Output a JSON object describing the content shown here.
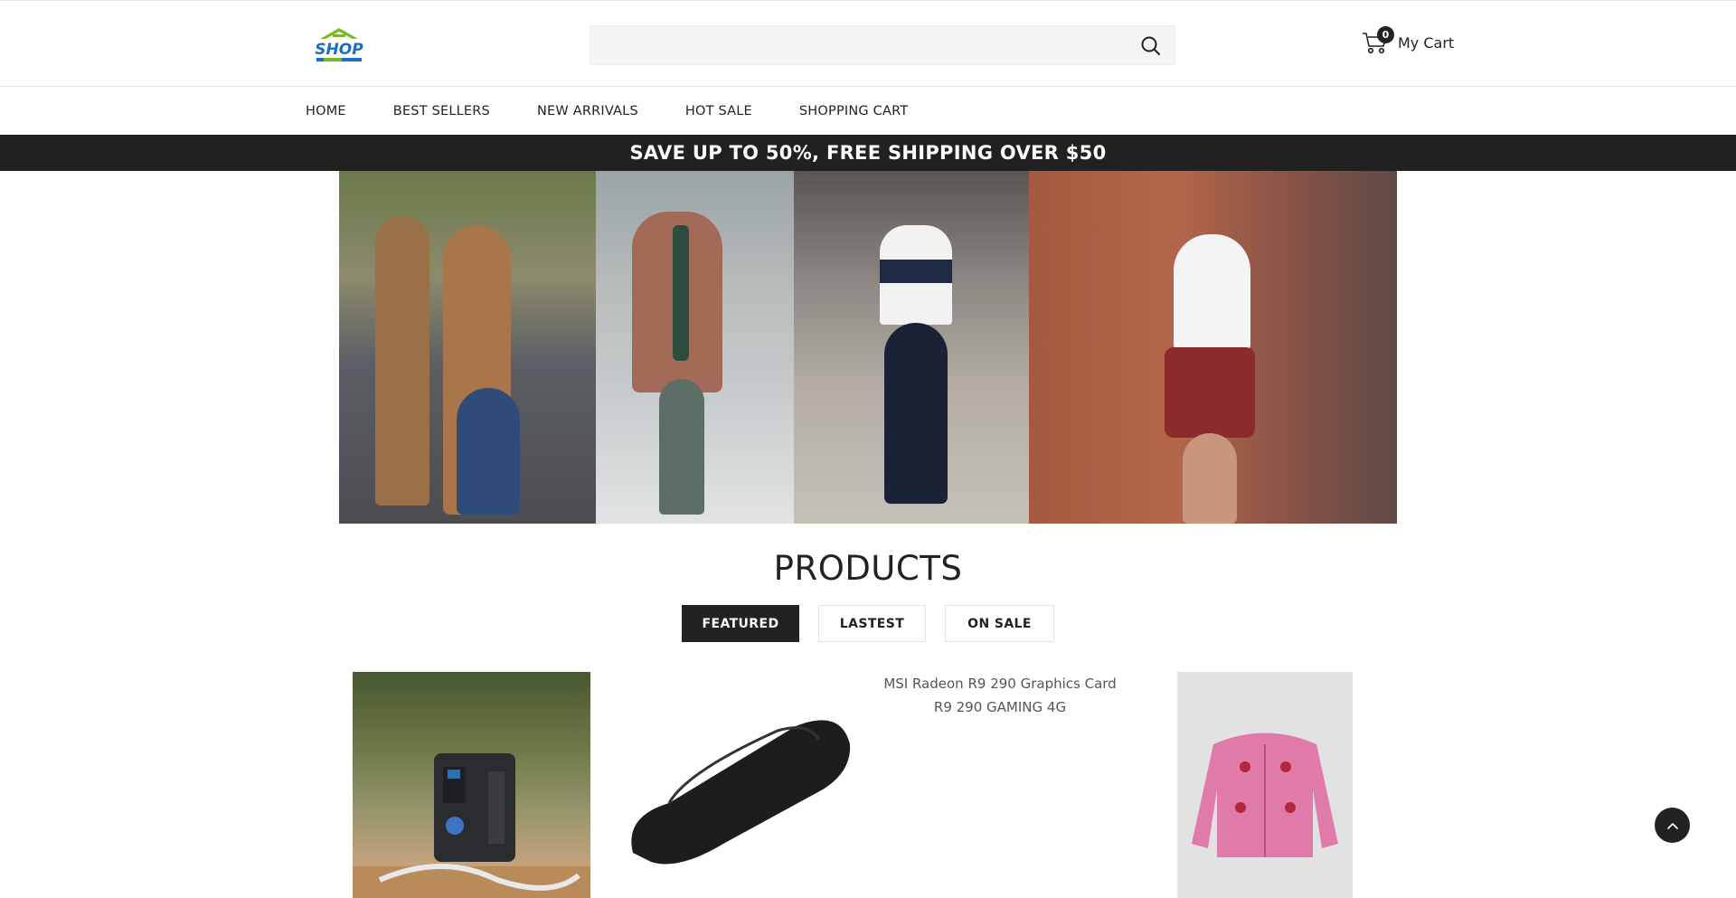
{
  "header": {
    "logo_text": "SHOP",
    "search": {
      "value": "",
      "placeholder": ""
    },
    "cart": {
      "count": "0",
      "label": "My Cart"
    }
  },
  "nav": {
    "items": [
      {
        "label": "HOME"
      },
      {
        "label": "BEST SELLERS"
      },
      {
        "label": "NEW ARRIVALS"
      },
      {
        "label": "HOT SALE"
      },
      {
        "label": "SHOPPING CART"
      }
    ]
  },
  "promo": {
    "text": "SAVE UP TO 50%, FREE SHIPPING OVER $50"
  },
  "products": {
    "title": "PRODUCTS",
    "tabs": [
      {
        "label": "FEATURED",
        "active": true
      },
      {
        "label": "LASTEST",
        "active": false
      },
      {
        "label": "ON SALE",
        "active": false
      }
    ],
    "items": [
      {
        "alt": ""
      },
      {
        "alt": ""
      },
      {
        "alt": "MSI Radeon R9 290 Graphics Card R9 290 GAMING 4G"
      },
      {
        "alt": ""
      }
    ]
  },
  "colors": {
    "promo_bg": "#212121",
    "active_tab_bg": "#222222",
    "logo_green": "#7cb82f",
    "logo_blue": "#1b6fc3"
  },
  "icons": [
    "shop-logo-icon",
    "search-icon",
    "cart-icon",
    "chevron-up-icon"
  ]
}
